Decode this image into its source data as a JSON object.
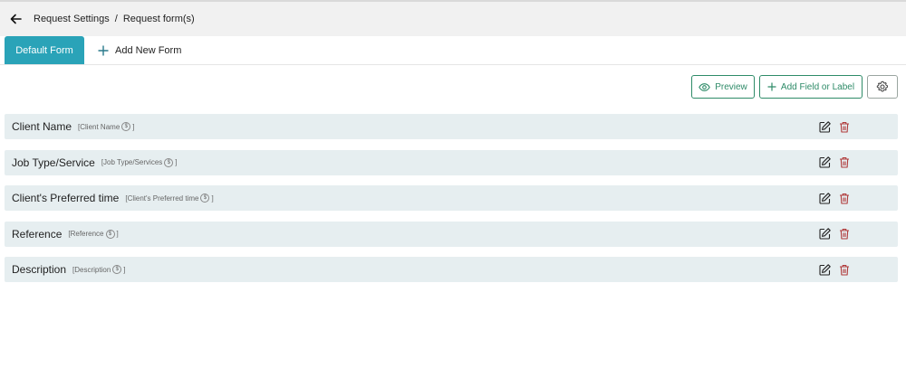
{
  "breadcrumb": {
    "parent": "Request Settings",
    "separator": "/",
    "current": "Request form(s)"
  },
  "tabs": {
    "default_label": "Default Form",
    "add_label": "Add New Form"
  },
  "toolbar": {
    "preview_label": "Preview",
    "add_field_label": "Add Field or Label"
  },
  "fields": [
    {
      "name": "Client Name",
      "tag_open": "[Client Name",
      "tag_close": "]"
    },
    {
      "name": "Job Type/Service",
      "tag_open": "[Job Type/Services",
      "tag_close": "]"
    },
    {
      "name": "Client's Preferred time",
      "tag_open": "[Client's Preferred time",
      "tag_close": "]"
    },
    {
      "name": "Reference",
      "tag_open": "[Reference",
      "tag_close": "]"
    },
    {
      "name": "Description",
      "tag_open": "[Description",
      "tag_close": "]"
    }
  ],
  "currency_symbol": "$",
  "icons": {
    "back": "arrow-left-icon",
    "add": "plus-icon",
    "preview": "eye-icon",
    "settings": "gear-icon",
    "edit": "edit-icon",
    "delete": "trash-icon"
  },
  "colors": {
    "accent": "#2aa3b8",
    "button_green": "#2e8b68",
    "row_bg": "#e6eef0",
    "delete_red": "#b03a3a"
  }
}
